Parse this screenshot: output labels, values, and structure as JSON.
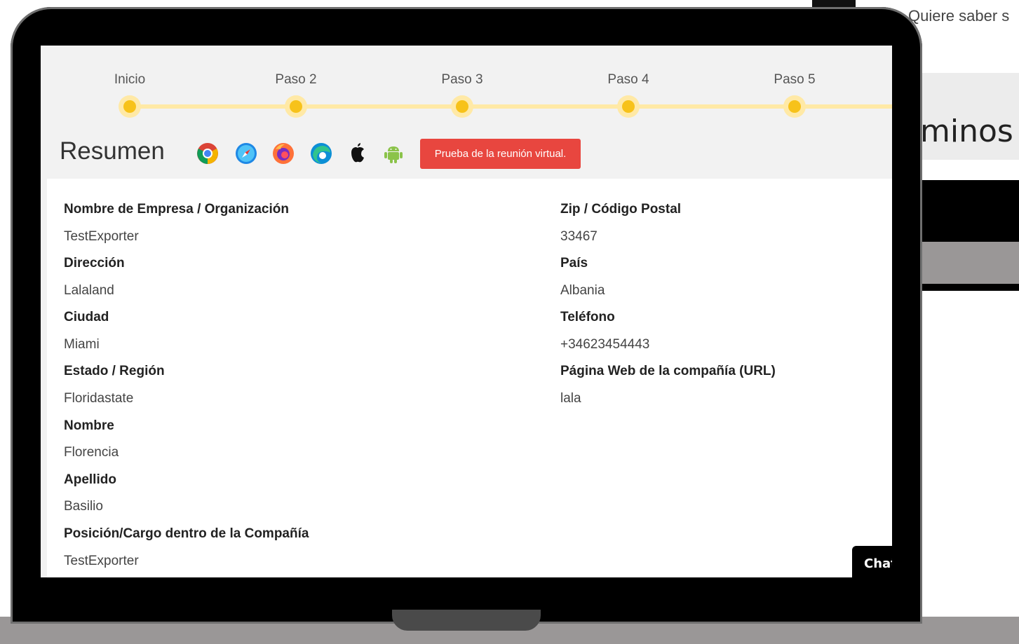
{
  "background": {
    "side_text": "Quiere saber s",
    "heading_fragment": "minos"
  },
  "stepper": {
    "steps": [
      "Inicio",
      "Paso 2",
      "Paso 3",
      "Paso 4",
      "Paso 5"
    ]
  },
  "summary": {
    "title": "Resumen",
    "browser_icons": [
      "chrome-icon",
      "safari-icon",
      "firefox-icon",
      "edge-icon",
      "apple-icon",
      "android-icon"
    ],
    "test_button_label": "Prueba de la reunión virtual.",
    "left_fields": [
      {
        "label": "Nombre de Empresa / Organización",
        "value": "TestExporter"
      },
      {
        "label": "Dirección",
        "value": "Lalaland"
      },
      {
        "label": "Ciudad",
        "value": "Miami"
      },
      {
        "label": "Estado / Región",
        "value": "Floridastate"
      },
      {
        "label": "Nombre",
        "value": "Florencia"
      },
      {
        "label": "Apellido",
        "value": "Basilio"
      },
      {
        "label": "Posición/Cargo dentro de la Compañía",
        "value": "TestExporter"
      }
    ],
    "right_fields": [
      {
        "label": "Zip / Código Postal",
        "value": "33467"
      },
      {
        "label": "País",
        "value": "Albania"
      },
      {
        "label": "Teléfono",
        "value": "+34623454443"
      },
      {
        "label": "Página Web de la compañía (URL)",
        "value": "lala"
      }
    ]
  },
  "chat": {
    "label": "Chat"
  },
  "colors": {
    "accent_button": "#e8463f",
    "stepper_dot": "#f7c21a",
    "stepper_track": "#ffe9a6"
  }
}
